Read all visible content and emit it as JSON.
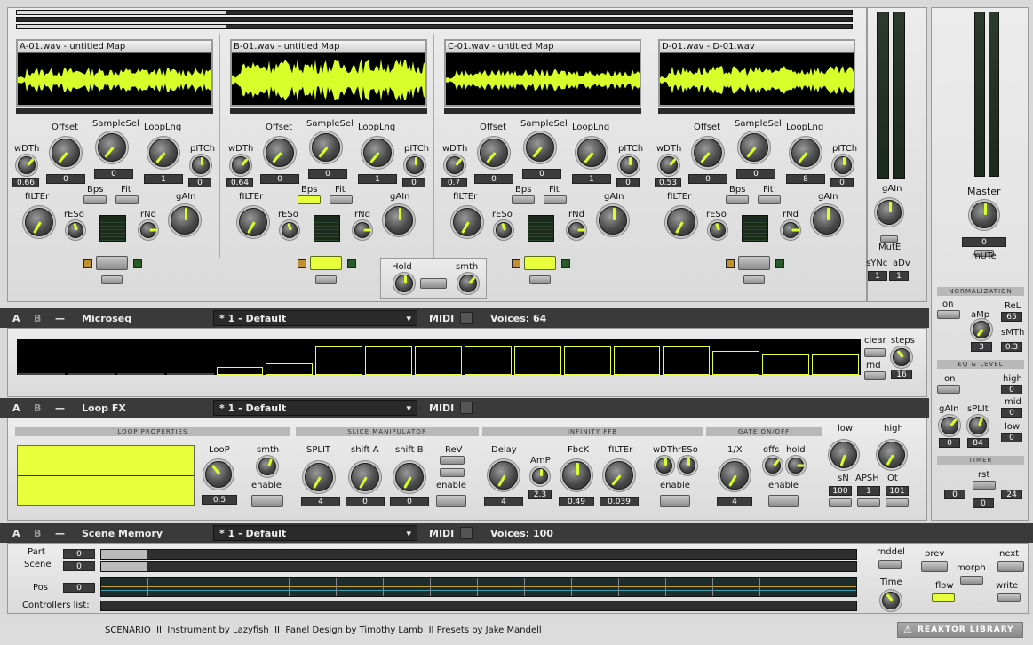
{
  "accent": "#e8ff3c",
  "decks": [
    {
      "title": "A-01.wav - untitled Map",
      "labels": {
        "offset": "Offset",
        "samplesel": "SampleSel",
        "looplng": "LoopLng",
        "width": "wDTh",
        "pitch": "pITCh",
        "filter": "fILTEr",
        "reso": "rESo",
        "bps": "Bps",
        "fit": "Fit",
        "rnd": "rNd",
        "gain": "gAIn"
      },
      "width_val": "0.66",
      "offset_val": "0",
      "samplesel_val": "0",
      "looplng_val": "1",
      "pitch_val": "0"
    },
    {
      "title": "B-01.wav - untitled Map",
      "labels": {
        "offset": "Offset",
        "samplesel": "SampleSel",
        "looplng": "LoopLng",
        "width": "wDTh",
        "pitch": "pITCh",
        "filter": "fILTEr",
        "reso": "rESo",
        "bps": "Bps",
        "fit": "Fit",
        "rnd": "rNd",
        "gain": "gAIn"
      },
      "width_val": "0.64",
      "offset_val": "0",
      "samplesel_val": "0",
      "looplng_val": "1",
      "pitch_val": "0"
    },
    {
      "title": "C-01.wav - untitled Map",
      "labels": {
        "offset": "Offset",
        "samplesel": "SampleSel",
        "looplng": "LoopLng",
        "width": "wDTh",
        "pitch": "pITCh",
        "filter": "fILTEr",
        "reso": "rESo",
        "bps": "Bps",
        "fit": "Fit",
        "rnd": "rNd",
        "gain": "gAIn"
      },
      "width_val": "0.7",
      "offset_val": "0",
      "samplesel_val": "0",
      "looplng_val": "1",
      "pitch_val": "0"
    },
    {
      "title": "D-01.wav - D-01.wav",
      "labels": {
        "offset": "Offset",
        "samplesel": "SampleSel",
        "looplng": "LoopLng",
        "width": "wDTh",
        "pitch": "pITCh",
        "filter": "fILTEr",
        "reso": "rESo",
        "bps": "Bps",
        "fit": "Fit",
        "rnd": "rNd",
        "gain": "gAIn"
      },
      "width_val": "0.53",
      "offset_val": "0",
      "samplesel_val": "0",
      "looplng_val": "8",
      "pitch_val": "0"
    }
  ],
  "hold": {
    "hold": "Hold",
    "smth": "smth"
  },
  "mix": {
    "gain": "gAIn",
    "mute": "MutE",
    "sync": "sYNc",
    "adv": "aDv",
    "sync_val": "1",
    "adv_val": "1"
  },
  "master": {
    "label": "Master",
    "value": "0",
    "mute": "mUTe"
  },
  "normalization": {
    "title": "NORMALIZATION",
    "on": "on",
    "amp": "aMp",
    "rel": "ReL",
    "rel_val": "65",
    "smth": "sMTh",
    "smth_val": "0.3",
    "amp_val": "3"
  },
  "eq": {
    "title": "EQ & LEVEL",
    "on": "on",
    "high": "high",
    "high_val": "0",
    "mid": "mid",
    "mid_val": "0",
    "low": "low",
    "low_val": "0",
    "gain": "gAIn",
    "split": "sPLIt",
    "gain_val": "0",
    "split_val": "84"
  },
  "timer": {
    "title": "TIMER",
    "rst": "rst",
    "v1": "0",
    "v2": "0",
    "v3": "24"
  },
  "microseq": {
    "a": "A",
    "b": "B",
    "dash": "—",
    "name": "Microseq",
    "preset": "* 1 - Default",
    "midi": "MIDI",
    "voices": "Voices: 64",
    "clear": "clear",
    "steps": "steps",
    "rnd": "rnd",
    "steps_val": "16",
    "step_levels": [
      0,
      0,
      0,
      0,
      0.25,
      0.35,
      0.85,
      0.85,
      0.85,
      0.85,
      0.85,
      0.85,
      0.85,
      0.85,
      0.7,
      0.6,
      0.6
    ]
  },
  "loopfx": {
    "a": "A",
    "b": "B",
    "dash": "—",
    "name": "Loop FX",
    "preset": "* 1 - Default",
    "midi": "MIDI",
    "sec_loop": "LOOP PROPERTIES",
    "sec_slice": "SLICE MANIPULATOR",
    "sec_inf": "INFINITY FFB",
    "sec_gate": "GATE ON/OFF",
    "loop": "LooP",
    "smth": "smth",
    "enable": "enable",
    "loop_val": "0.5",
    "split": "SPLIT",
    "shifta": "shift A",
    "shiftb": "shift B",
    "rev": "ReV",
    "split_val": "4",
    "shifta_val": "0",
    "shiftb_val": "0",
    "delay": "Delay",
    "amp": "AmP",
    "fbck": "FbcK",
    "filter": "fILTEr",
    "width": "wDTh",
    "reso": "rESo",
    "delay_val": "4",
    "amp_val": "2.3",
    "fbck_val": "0.49",
    "filter_val": "0.039",
    "onex": "1/X",
    "offs": "offs",
    "hold": "hold",
    "onex_val": "4",
    "low": "low",
    "high": "high",
    "sn": "sN",
    "apsh": "APSH",
    "ot": "Ot",
    "sn_val": "100",
    "apsh_val": "1",
    "ot_val": "101"
  },
  "scene": {
    "a": "A",
    "b": "B",
    "dash": "—",
    "name": "Scene Memory",
    "preset": "* 1 - Default",
    "midi": "MIDI",
    "voices": "Voices: 100",
    "part": "Part",
    "scene": "Scene",
    "pos": "Pos",
    "part_val": "0",
    "scene_val": "0",
    "pos_val": "0",
    "controllers": "Controllers list:",
    "rnddel": "rnddel",
    "time": "Time",
    "prev": "prev",
    "next": "next",
    "morph": "morph",
    "flow": "flow",
    "write": "write"
  },
  "footer": {
    "credits": "SCENARIO  II  Instrument by Lazyfish  II  Panel Design by Timothy Lamb  II Presets by Jake Mandell",
    "logo": "REAKTOR LIBRARY"
  }
}
